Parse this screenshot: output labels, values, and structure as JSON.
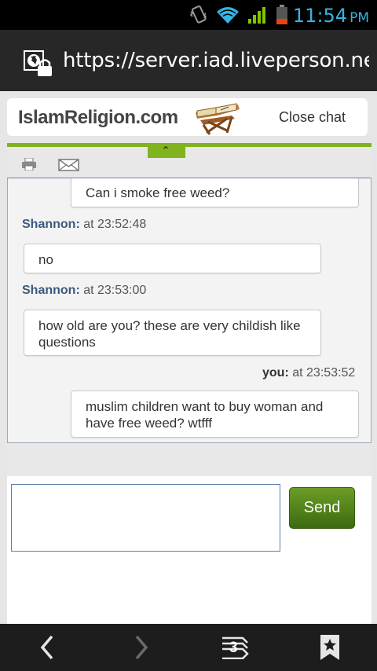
{
  "status_bar": {
    "time": "11:54",
    "ampm": "PM",
    "icons": [
      "vibrate-icon",
      "wifi-icon",
      "signal-icon",
      "battery-icon"
    ]
  },
  "browser": {
    "url": "https://server.iad.liveperson.net",
    "tab_count": "3"
  },
  "header": {
    "logo_text": "IslamReligion.com",
    "close_label": "Close chat"
  },
  "transcript": {
    "messages": [
      {
        "speaker": "",
        "time": "",
        "text": "Can i smoke free weed?",
        "from": "you"
      },
      {
        "speaker": "Shannon:",
        "time": "at 23:52:48",
        "text": "no",
        "from": "agent"
      },
      {
        "speaker": "Shannon:",
        "time": "at 23:53:00",
        "text": "how old are you? these are very childish like questions",
        "from": "agent"
      },
      {
        "speaker": "you:",
        "time": "at 23:53:52",
        "text": "muslim children want to buy woman and have free weed? wtfff",
        "from": "you"
      }
    ]
  },
  "composer": {
    "value": "",
    "send_label": "Send"
  },
  "colors": {
    "accent_green": "#80b31e",
    "agent_name": "#3b5a80",
    "status_blue": "#33b5e5"
  }
}
